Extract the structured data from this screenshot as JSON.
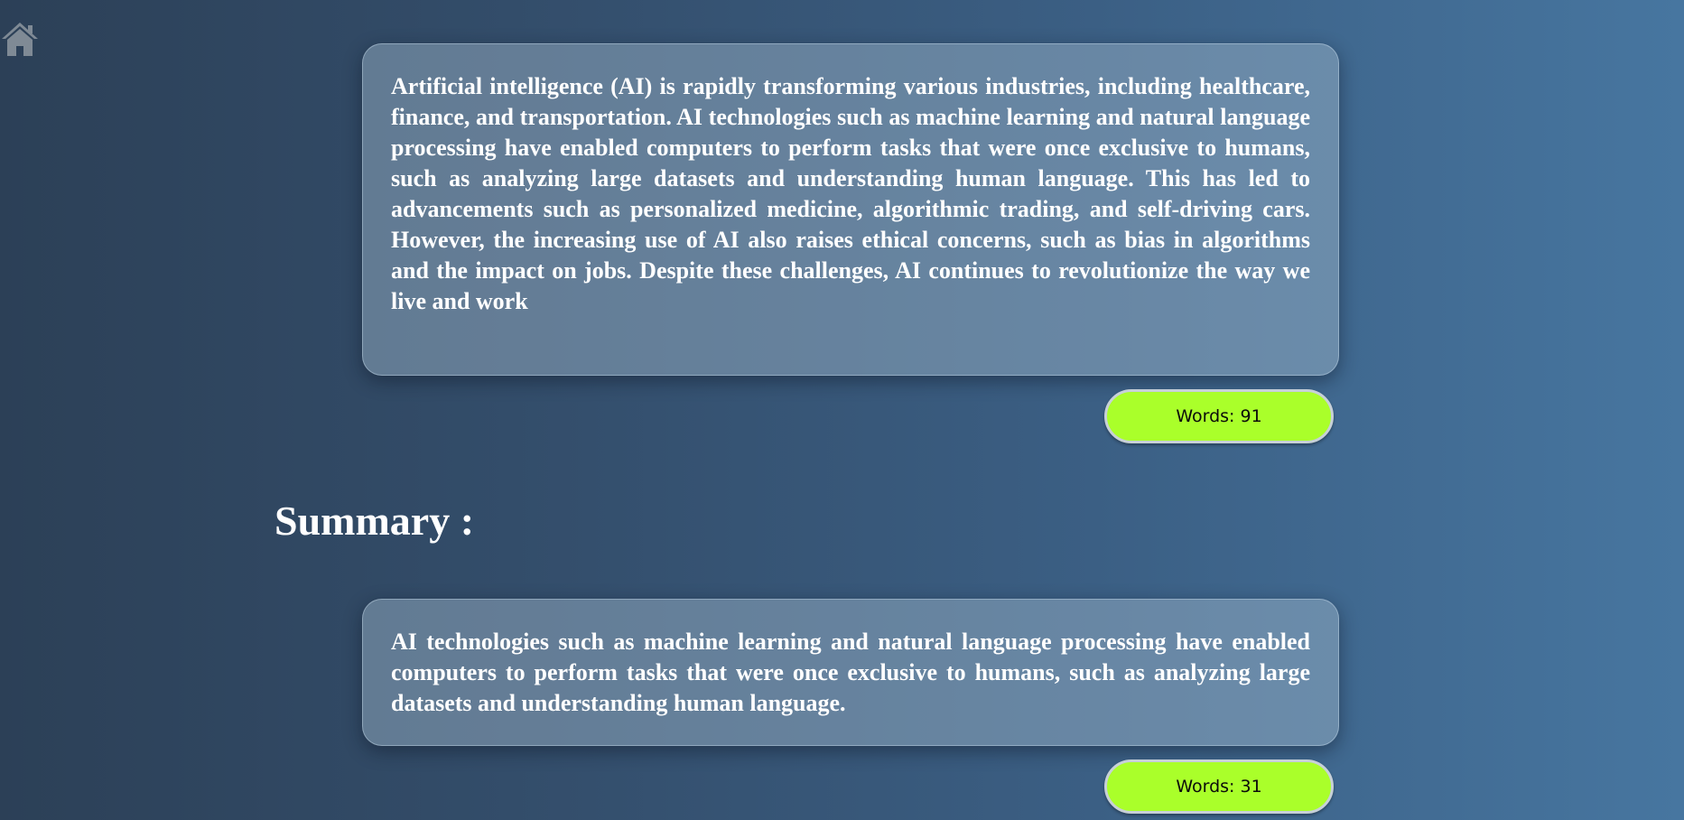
{
  "nav": {
    "home_icon": "home-icon",
    "icon_color": "#7f8a95"
  },
  "original": {
    "text": "Artificial intelligence (AI) is rapidly transforming various industries, including healthcare, finance, and transportation. AI technologies such as machine learning and natural language processing have enabled computers to perform tasks that were once exclusive to humans, such as analyzing large datasets and understanding human language. This has led to advancements such as personalized medicine, algorithmic trading, and self-driving cars. However, the increasing use of AI also raises ethical concerns, such as bias in algorithms and the impact on jobs. Despite these challenges, AI continues to revolutionize the way we live and work",
    "word_count_label": "Words: 91"
  },
  "summary": {
    "heading": "Summary :",
    "text": "AI technologies such as machine learning and natural language processing have enabled computers to perform tasks that were once exclusive to humans, such as analyzing large datasets and understanding human language.",
    "word_count_label": "Words: 31"
  },
  "colors": {
    "pill_background": "#aaff2a",
    "card_text": "#ffffff",
    "background_dark": "#2c4057",
    "background_light": "#4776a0"
  }
}
